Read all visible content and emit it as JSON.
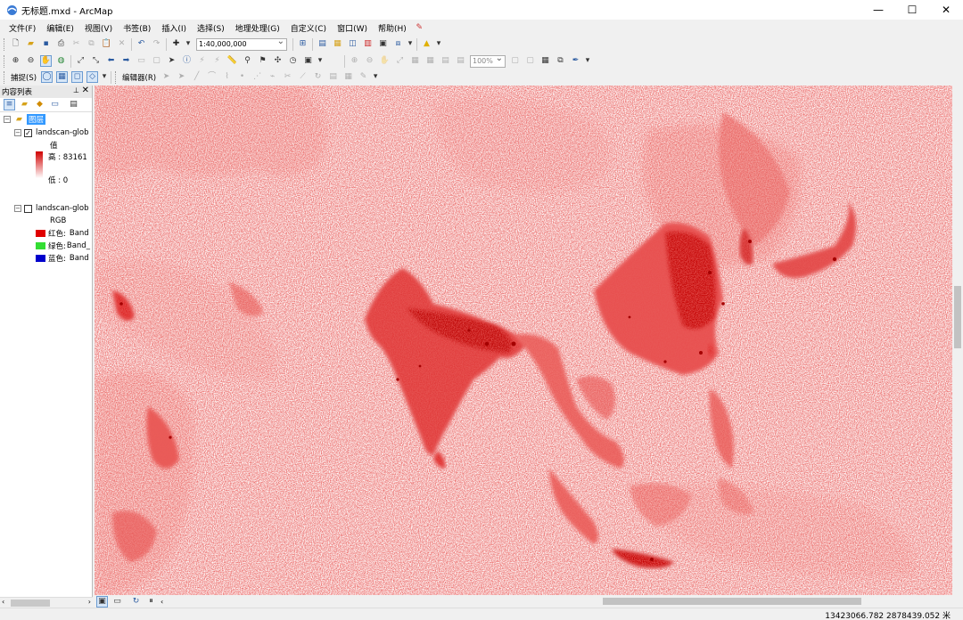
{
  "window": {
    "title": "无标题.mxd - ArcMap",
    "controls": {
      "minimize": "—",
      "maximize": "☐",
      "close": "✕"
    }
  },
  "menu": [
    "文件(F)",
    "编辑(E)",
    "视图(V)",
    "书签(B)",
    "插入(I)",
    "选择(S)",
    "地理处理(G)",
    "自定义(C)",
    "窗口(W)",
    "帮助(H)"
  ],
  "toolbar": {
    "scale": "1:40,000,000",
    "zoom_percent": "100%",
    "snapping_label": "捕捉(S)",
    "editor_label": "编辑器(R)"
  },
  "toc": {
    "title": "内容列表",
    "layers_group": "图层",
    "layer1": {
      "name": "landscan-glob",
      "checked": true,
      "legend_title": "值",
      "high_label": "高 : 83161",
      "low_label": "低 : 0",
      "color_high": "#d00000",
      "color_low": "#ffffff"
    },
    "layer2": {
      "name": "landscan-glob",
      "checked": false,
      "legend_title": "RGB",
      "bands": [
        {
          "label": "红色:",
          "value": "Band",
          "color": "#e00000"
        },
        {
          "label": "绿色:",
          "value": "Band_",
          "color": "#33dd33"
        },
        {
          "label": "蓝色:",
          "value": "Band",
          "color": "#0000cc"
        }
      ]
    }
  },
  "status": {
    "coordinates": "13423066.782  2878439.052 米"
  },
  "map": {
    "colors": {
      "dense": "#c40000",
      "medium": "#e8494a",
      "light": "#f7b7b4",
      "background": "#ffffff"
    }
  }
}
